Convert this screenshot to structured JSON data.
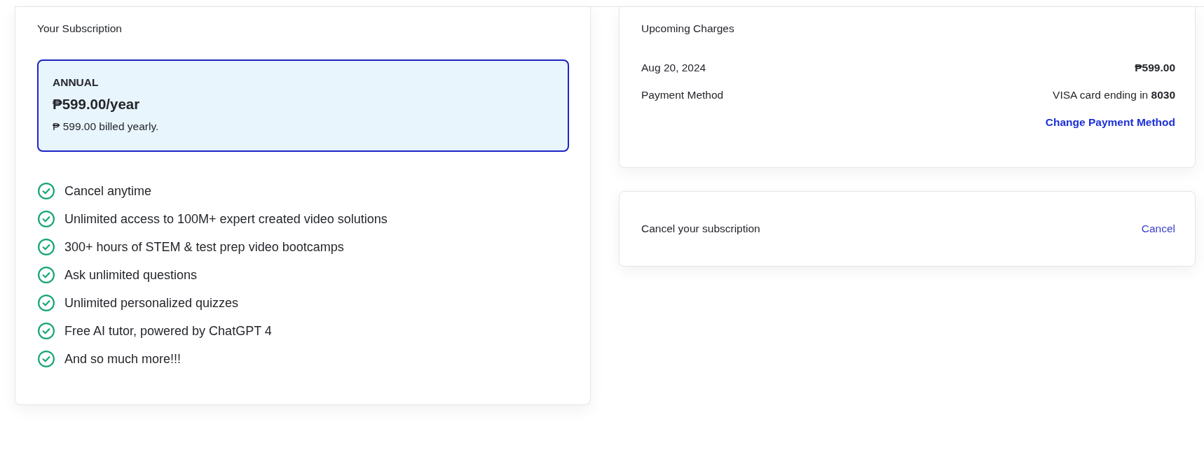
{
  "subscription": {
    "title": "Your Subscription",
    "plan": {
      "name": "ANNUAL",
      "price": "₱599.00/year",
      "billing": "₱ 599.00 billed yearly.",
      "selected": true
    },
    "features": [
      "Cancel anytime",
      "Unlimited access to 100M+ expert created video solutions",
      "300+ hours of STEM & test prep video bootcamps",
      "Ask unlimited questions",
      "Unlimited personalized quizzes",
      "Free AI tutor, powered by ChatGPT 4",
      "And so much more!!!"
    ]
  },
  "upcoming_charges": {
    "title": "Upcoming Charges",
    "rows": [
      {
        "kind": "amount",
        "label": "Aug 20, 2024",
        "value": "₱599.00"
      },
      {
        "kind": "method",
        "label": "Payment Method",
        "value": "VISA card ending in **8030**"
      }
    ],
    "link": "Change Payment Method"
  },
  "cancel_section": {
    "label": "Cancel your subscription",
    "link": "Cancel"
  }
}
